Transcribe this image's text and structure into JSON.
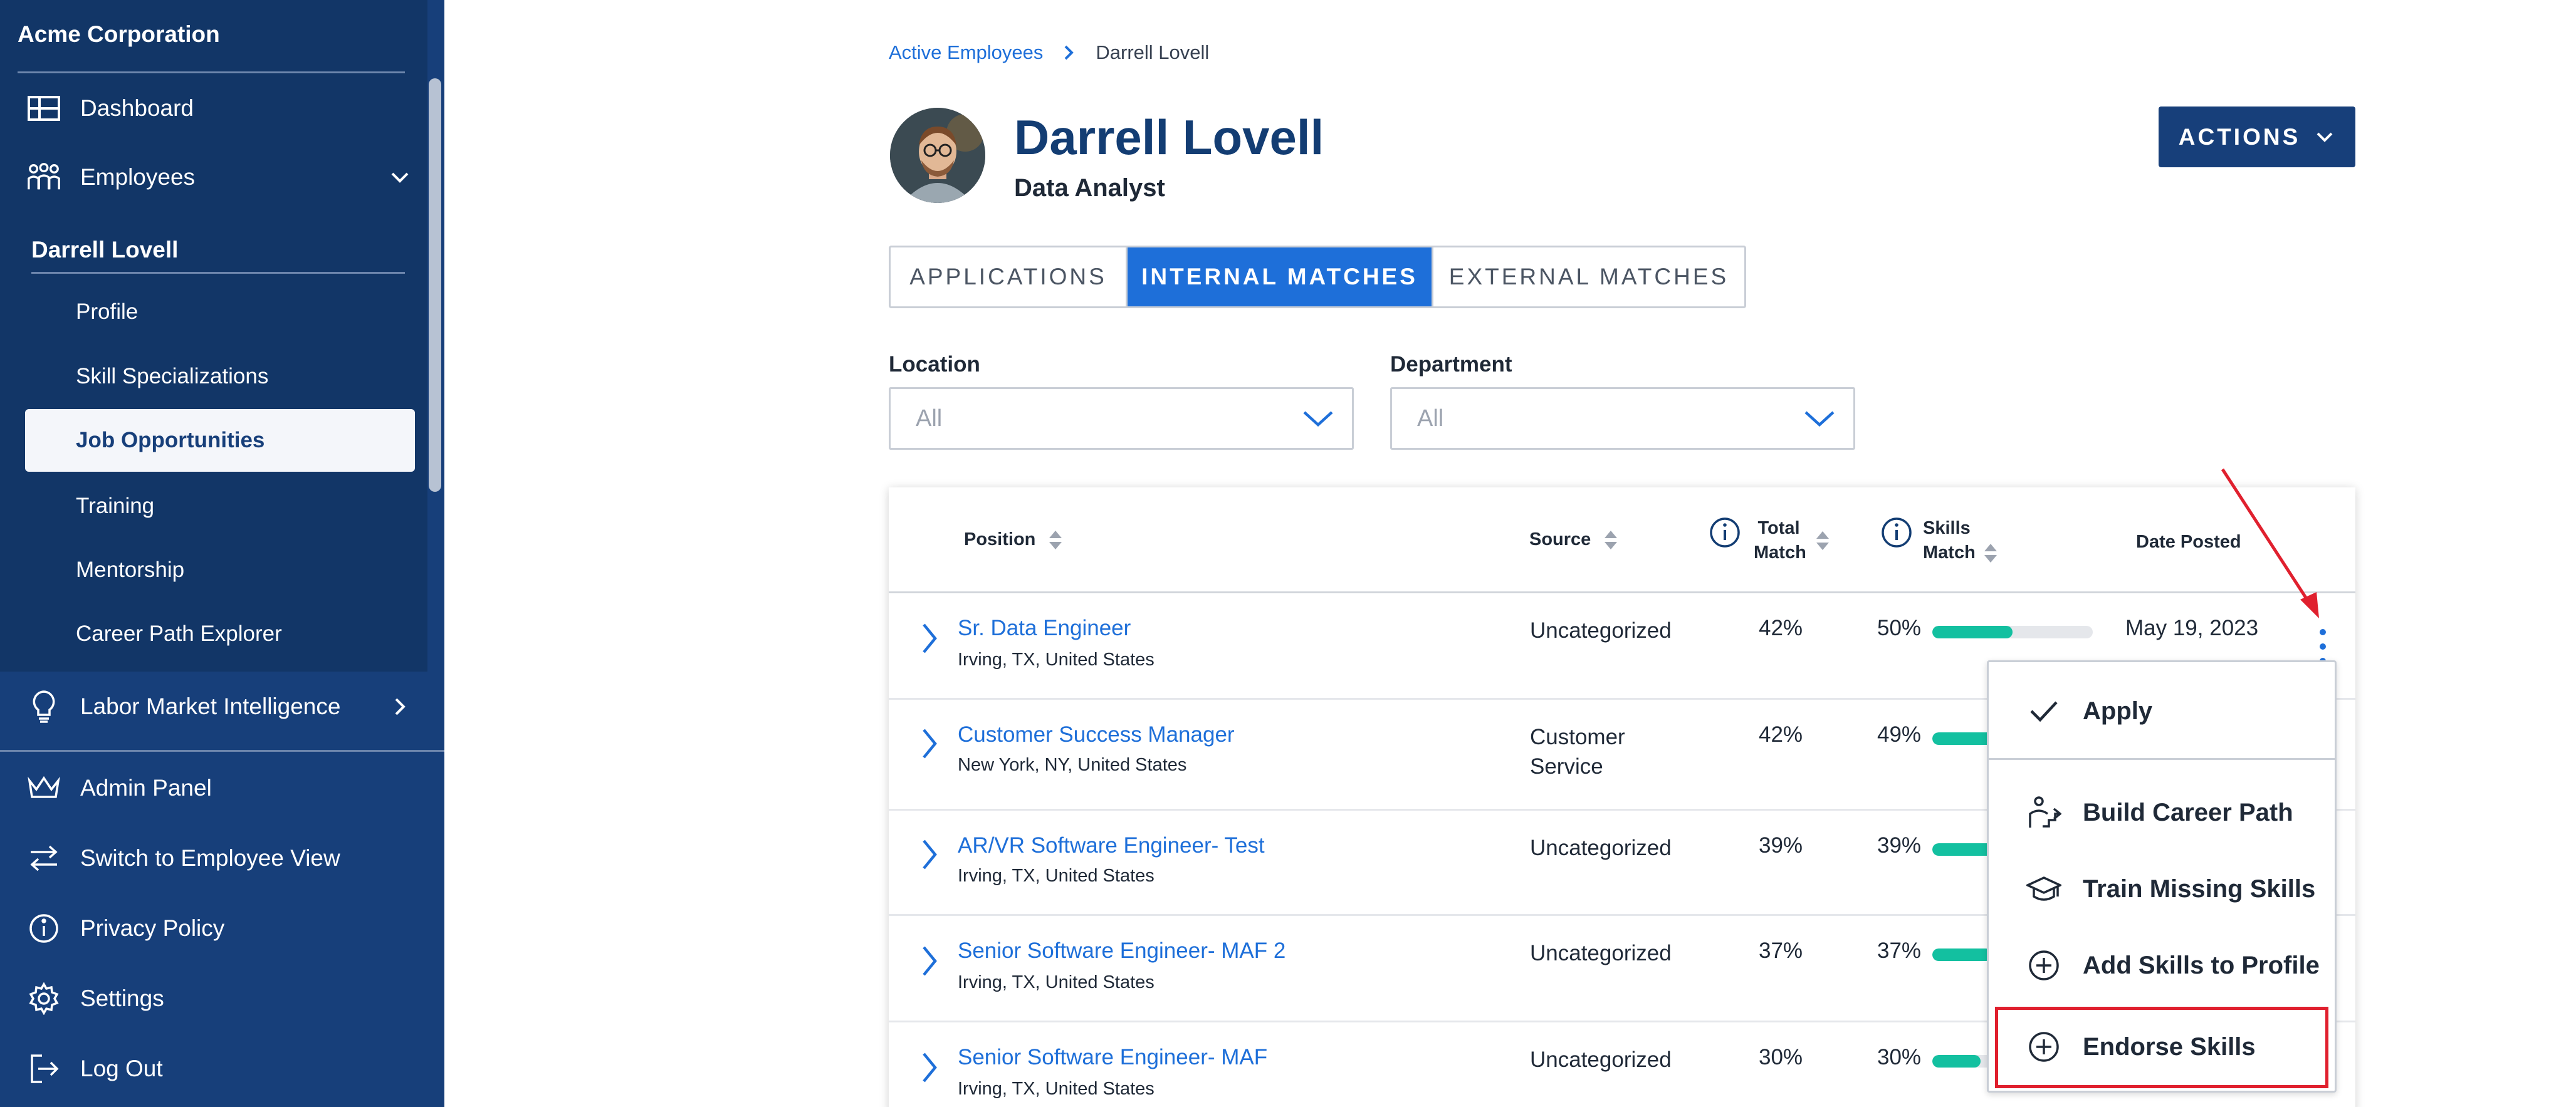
{
  "sidebar": {
    "brand": "Acme Corporation",
    "dashboard": "Dashboard",
    "employees": "Employees",
    "employee_name": "Darrell Lovell",
    "sub_items": [
      "Profile",
      "Skill Specializations",
      "Training",
      "Mentorship",
      "Career Path Explorer"
    ],
    "active_sub_item": "Job Opportunities",
    "labor_market": "Labor Market Intelligence",
    "admin_panel": "Admin Panel",
    "switch_view": "Switch to Employee View",
    "privacy": "Privacy Policy",
    "settings": "Settings",
    "logout": "Log Out"
  },
  "breadcrumb": {
    "parent": "Active Employees",
    "current": "Darrell Lovell"
  },
  "employee": {
    "name": "Darrell Lovell",
    "title": "Data Analyst"
  },
  "actions_label": "ACTIONS",
  "tabs": [
    {
      "label": "APPLICATIONS",
      "active": false
    },
    {
      "label": "INTERNAL MATCHES",
      "active": true
    },
    {
      "label": "EXTERNAL MATCHES",
      "active": false
    }
  ],
  "filters": {
    "location": {
      "label": "Location",
      "value": "All"
    },
    "department": {
      "label": "Department",
      "value": "All"
    }
  },
  "table": {
    "headers": {
      "position": "Position",
      "source": "Source",
      "total_match_1": "Total",
      "total_match_2": "Match",
      "skills_match_1": "Skills",
      "skills_match_2": "Match",
      "date_posted": "Date Posted"
    },
    "rows": [
      {
        "title": "Sr. Data Engineer",
        "location": "Irving, TX, United States",
        "source_1": "Uncategorized",
        "source_2": "",
        "total": "42%",
        "skills": "50%",
        "skills_fraction": 0.5,
        "date": "May 19, 2023"
      },
      {
        "title": "Customer Success Manager",
        "location": "New York, NY, United States",
        "source_1": "Customer",
        "source_2": "Service",
        "total": "42%",
        "skills": "49%",
        "skills_fraction": 0.49,
        "date": ""
      },
      {
        "title": "AR/VR Software Engineer- Test",
        "location": "Irving, TX, United States",
        "source_1": "Uncategorized",
        "source_2": "",
        "total": "39%",
        "skills": "39%",
        "skills_fraction": 0.39,
        "date": ""
      },
      {
        "title": "Senior Software Engineer- MAF 2",
        "location": "Irving, TX, United States",
        "source_1": "Uncategorized",
        "source_2": "",
        "total": "37%",
        "skills": "37%",
        "skills_fraction": 0.37,
        "date": ""
      },
      {
        "title": "Senior Software Engineer- MAF",
        "location": "Irving, TX, United States",
        "source_1": "Uncategorized",
        "source_2": "",
        "total": "30%",
        "skills": "30%",
        "skills_fraction": 0.3,
        "date": ""
      }
    ]
  },
  "menu": {
    "apply": "Apply",
    "build_career_path": "Build Career Path",
    "train_missing_skills": "Train Missing Skills",
    "add_skills": "Add Skills to Profile",
    "endorse_skills": "Endorse Skills"
  },
  "colors": {
    "sidebar": "#173f7a",
    "accent": "#1e6fd9",
    "progress": "#13c0a0",
    "highlight": "#e0202e"
  }
}
